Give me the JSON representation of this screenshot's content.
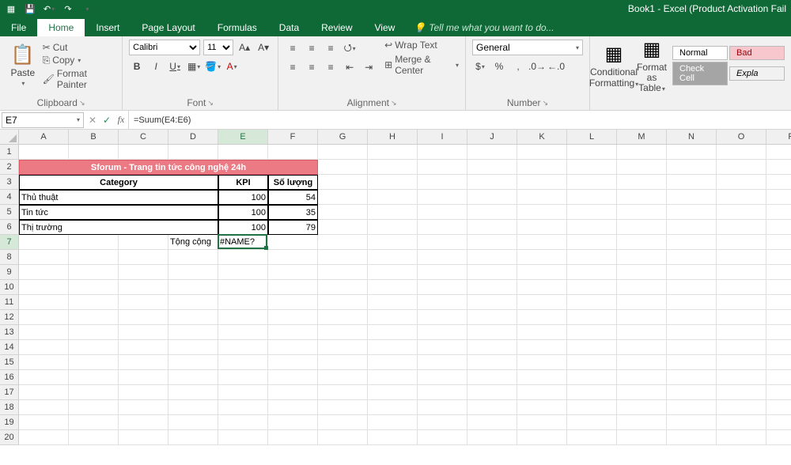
{
  "app": {
    "title": "Book1 - Excel (Product Activation Fail"
  },
  "qat": {
    "save": "save-icon",
    "undo": "undo-icon",
    "redo": "redo-icon"
  },
  "tabs": [
    "File",
    "Home",
    "Insert",
    "Page Layout",
    "Formulas",
    "Data",
    "Review",
    "View"
  ],
  "tell": "Tell me what you want to do...",
  "ribbon": {
    "clipboard": {
      "paste": "Paste",
      "cut": "Cut",
      "copy": "Copy",
      "painter": "Format Painter",
      "label": "Clipboard"
    },
    "font": {
      "name": "Calibri",
      "size": "11",
      "bold": "B",
      "italic": "I",
      "underline": "U",
      "label": "Font"
    },
    "alignment": {
      "wrap": "Wrap Text",
      "merge": "Merge & Center",
      "label": "Alignment"
    },
    "number": {
      "format": "General",
      "label": "Number"
    },
    "styles": {
      "cond": "Conditional Formatting",
      "fmttbl": "Format as Table",
      "normal": "Normal",
      "bad": "Bad",
      "check": "Check Cell",
      "explan": "Expla"
    }
  },
  "namebox": "E7",
  "formula": "=Suum(E4:E6)",
  "columns": [
    "A",
    "B",
    "C",
    "D",
    "E",
    "F",
    "G",
    "H",
    "I",
    "J",
    "K",
    "L",
    "M",
    "N",
    "O",
    "P"
  ],
  "rows": [
    "1",
    "2",
    "3",
    "4",
    "5",
    "6",
    "7",
    "8",
    "9",
    "10",
    "11",
    "12",
    "13",
    "14",
    "15",
    "16",
    "17",
    "18",
    "19",
    "20"
  ],
  "data": {
    "title": "Sforum - Trang tin tức công nghệ 24h",
    "head_category": "Category",
    "head_kpi": "KPI",
    "head_qty": "Số lượng",
    "r4_cat": "Thủ thuật",
    "r4_kpi": "100",
    "r4_qty": "54",
    "r5_cat": "Tin tức",
    "r5_kpi": "100",
    "r5_qty": "35",
    "r6_cat": "Thị trường",
    "r6_kpi": "100",
    "r6_qty": "79",
    "total_label": "Tộng cộng",
    "total_val": "#NAME?"
  }
}
